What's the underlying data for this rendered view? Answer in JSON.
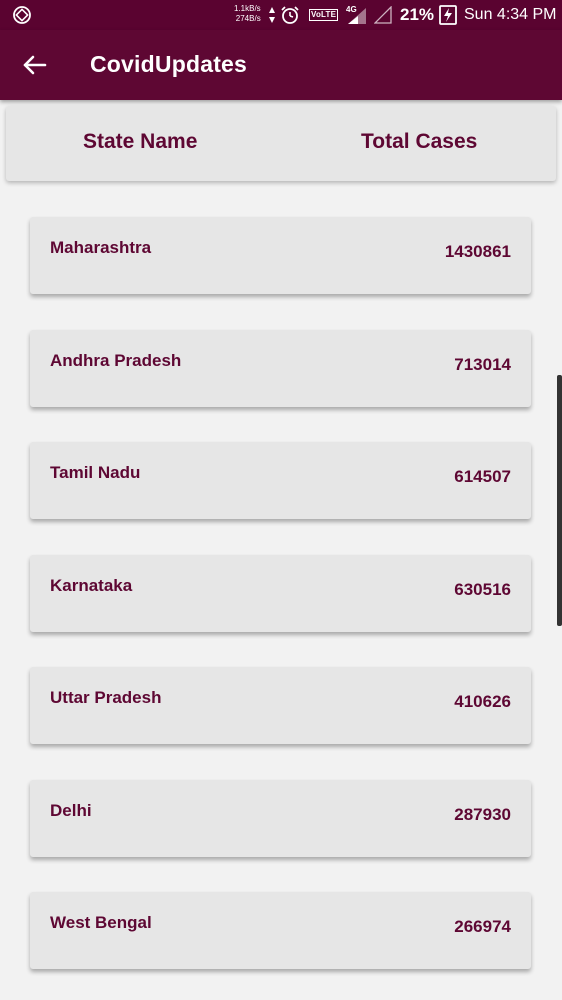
{
  "status_bar": {
    "net_up": "1.1kB/s",
    "net_down": "274B/s",
    "volte": "VoLTE",
    "network_type": "4G",
    "battery": "21%",
    "time": "Sun 4:34 PM",
    "icons": [
      "screen-rotate-icon",
      "data-arrows-icon",
      "alarm-icon",
      "signal-icon",
      "battery-charging-icon"
    ]
  },
  "app_bar": {
    "title": "CovidUpdates",
    "back_icon": "arrow-back-icon"
  },
  "header": {
    "state_label": "State Name",
    "cases_label": "Total Cases"
  },
  "rows": [
    {
      "state": "Maharashtra",
      "cases": "1430861"
    },
    {
      "state": "Andhra Pradesh",
      "cases": "713014"
    },
    {
      "state": "Tamil Nadu",
      "cases": "614507"
    },
    {
      "state": "Karnataka",
      "cases": "630516"
    },
    {
      "state": "Uttar Pradesh",
      "cases": "410626"
    },
    {
      "state": "Delhi",
      "cases": "287930"
    },
    {
      "state": "West Bengal",
      "cases": "266974"
    }
  ],
  "colors": {
    "primary": "#5e0733",
    "status_bar": "#5a0330",
    "card": "#e6e6e6",
    "background": "#f2f2f2"
  }
}
